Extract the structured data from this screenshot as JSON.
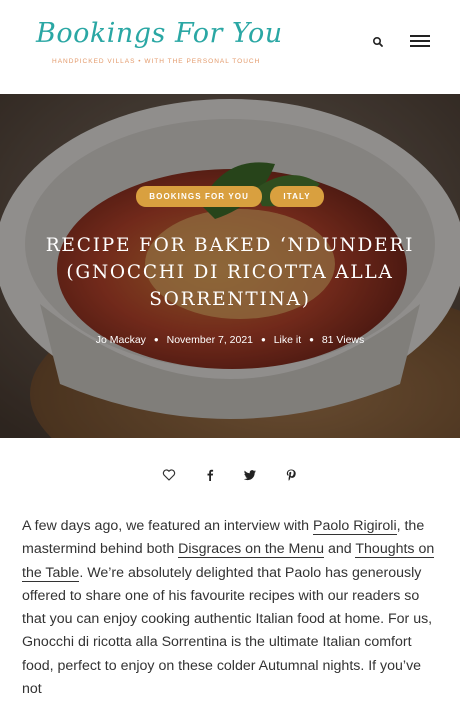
{
  "header": {
    "logo_text": "Bookings For You",
    "logo_tagline": "HANDPICKED VILLAS  •  WITH THE PERSONAL TOUCH",
    "search_icon": "search-icon",
    "menu_icon": "hamburger-menu-icon"
  },
  "hero": {
    "categories": [
      "BOOKINGS FOR YOU",
      "ITALY"
    ],
    "title": "RECIPE FOR BAKED ‘NDUNDERI (GNOCCHI DI RICOTTA ALLA SORRENTINA)",
    "meta": {
      "author": "Jo Mackay",
      "date": "November 7, 2021",
      "like": "Like it",
      "views": "81 Views"
    },
    "category_color": "#d9a03f"
  },
  "share": {
    "icons": [
      "heart-icon",
      "facebook-icon",
      "twitter-icon",
      "pinterest-icon"
    ]
  },
  "article": {
    "p1_a": "A few days ago, we featured an interview with ",
    "link1": "Paolo Rigiroli",
    "p1_b": ", the mastermind behind both ",
    "link2": "Disgraces on the Menu",
    "p1_c": " and ",
    "link3": "Thoughts on the Table",
    "p1_d": ". We’re absolutely delighted that Paolo has generously offered to share one of his favourite recipes with our readers so that you can enjoy cooking authentic Italian food at home. For us, Gnocchi di ricotta alla Sorrentina is the ultimate Italian comfort food, perfect to enjoy on these colder Autumnal nights. If you’ve not"
  },
  "colors": {
    "logo_teal": "#2aa7a4",
    "logo_tagline": "#e39a6b"
  }
}
